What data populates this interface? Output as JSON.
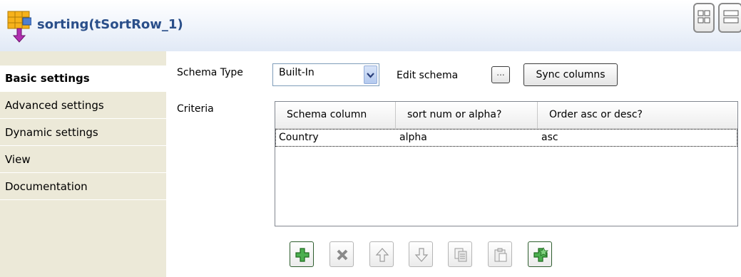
{
  "header": {
    "title": "sorting(tSortRow_1)",
    "icon": "sort-row-component-icon"
  },
  "sidebar": {
    "items": [
      {
        "label": "Basic settings",
        "active": true
      },
      {
        "label": "Advanced settings",
        "active": false
      },
      {
        "label": "Dynamic settings",
        "active": false
      },
      {
        "label": "View",
        "active": false
      },
      {
        "label": "Documentation",
        "active": false
      }
    ]
  },
  "form": {
    "schema_type_label": "Schema Type",
    "schema_type_value": "Built-In",
    "edit_schema_label": "Edit schema",
    "edit_schema_button": "...",
    "sync_columns_button": "Sync columns",
    "criteria_label": "Criteria"
  },
  "criteria_table": {
    "columns": [
      "Schema column",
      "sort num or alpha?",
      "Order asc or desc?"
    ],
    "rows": [
      [
        "Country",
        "alpha",
        "asc"
      ]
    ]
  },
  "toolbar": {
    "buttons": [
      {
        "icon": "add-icon",
        "enabled": true
      },
      {
        "icon": "delete-icon",
        "enabled": false
      },
      {
        "icon": "move-up-icon",
        "enabled": false
      },
      {
        "icon": "move-down-icon",
        "enabled": false
      },
      {
        "icon": "copy-icon",
        "enabled": false
      },
      {
        "icon": "paste-icon",
        "enabled": false
      },
      {
        "icon": "add-all-icon",
        "enabled": true
      }
    ]
  },
  "colors": {
    "title_text": "#2a4f8a",
    "sidebar_bg": "#ece9d8",
    "add_icon_green": "#3c9a3c"
  }
}
